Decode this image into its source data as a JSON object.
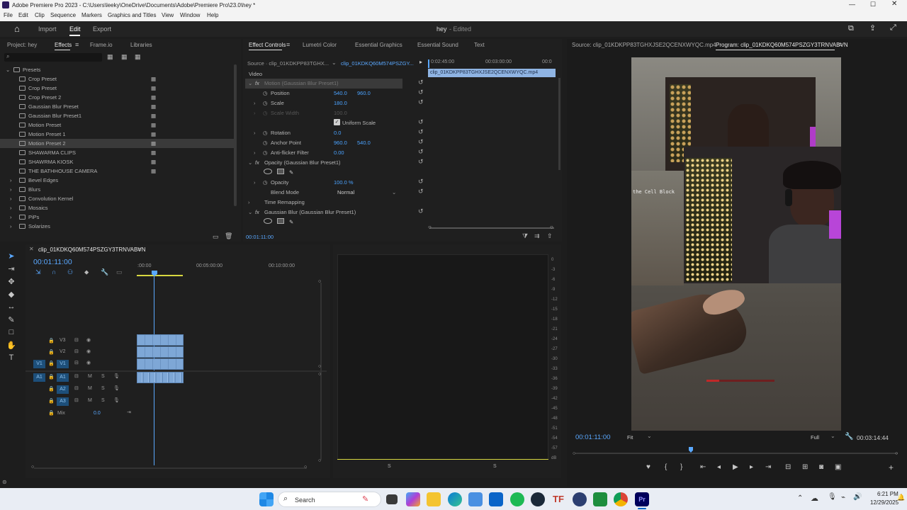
{
  "title": "Adobe Premiere Pro 2023 - C:\\Users\\leeky\\OneDrive\\Documents\\Adobe\\Premiere Pro\\23.0\\hey *",
  "menu": [
    "File",
    "Edit",
    "Clip",
    "Sequence",
    "Markers",
    "Graphics and Titles",
    "View",
    "Window",
    "Help"
  ],
  "workspace": {
    "import": "Import",
    "edit": "Edit",
    "export": "Export",
    "project_name": "hey",
    "status": "- Edited"
  },
  "effects_panel": {
    "tabs": [
      "Project: hey",
      "Effects",
      "Frame.io",
      "Libraries"
    ],
    "root": "Presets",
    "items": [
      "Crop Preset",
      "Crop Preset",
      "Crop Preset 2",
      "Gaussian Blur Preset",
      "Gaussian Blur Preset1",
      "Motion Preset",
      "Motion Preset 1",
      "Motion Preset 2",
      "SHAWARMA CLIPS",
      "SHAWRMA KIOSK",
      "THE BATHHOUSE CAMERA"
    ],
    "folders": [
      "Bevel Edges",
      "Blurs",
      "Convolution Kernel",
      "Mosaics",
      "PiPs",
      "Solarizes"
    ]
  },
  "effect_controls": {
    "tabs": [
      "Effect Controls",
      "Lumetri Color",
      "Essential Graphics",
      "Essential Sound",
      "Text"
    ],
    "source": "Source · clip_01KDKPP83TGHX...",
    "master": "clip_01KDKQ60M574PSZGY...",
    "video": "Video",
    "motion": "Motion (Gaussian Blur Preset1)",
    "position": {
      "label": "Position",
      "x": "540.0",
      "y": "960.0"
    },
    "scale": {
      "label": "Scale",
      "v": "180.0"
    },
    "scale_width": {
      "label": "Scale Width",
      "v": "100.0"
    },
    "uniform": "Uniform Scale",
    "rotation": {
      "label": "Rotation",
      "v": "0.0"
    },
    "anchor": {
      "label": "Anchor Point",
      "x": "960.0",
      "y": "540.0"
    },
    "flicker": {
      "label": "Anti-flicker Filter",
      "v": "0.00"
    },
    "opacity_group": "Opacity (Gaussian Blur Preset1)",
    "opacity": {
      "label": "Opacity",
      "v": "100.0 %"
    },
    "blend": {
      "label": "Blend Mode",
      "v": "Normal"
    },
    "time_remap": "Time Remapping",
    "gblur": "Gaussian Blur (Gaussian Blur Preset1)",
    "ruler": [
      "0:02:45:00",
      "00:03:00:00",
      "00:0"
    ],
    "clip": "clip_01KDKPP83TGHXJSE2QCENXWYQC.mp4",
    "timecode": "00:01:11:00"
  },
  "source_monitor": {
    "tab": "Source: clip_01KDKPP83TGHXJSE2QCENXWYQC.mp4"
  },
  "program": {
    "tab": "Program: clip_01KDKQ60M574PSZGY3TRNVABVN",
    "timecode": "00:01:11:00",
    "fit": "Fit",
    "full": "Full",
    "duration": "00:03:14:44",
    "overlay_text": "the Cell Block"
  },
  "timeline": {
    "tab": "clip_01KDKQ60M574PSZGY3TRNVABVN",
    "timecode": "00:01:11:00",
    "ruler": [
      ":00:00",
      "00:05:00:00",
      "00:10:00:00"
    ],
    "video_tracks": [
      "V3",
      "V2",
      "V1"
    ],
    "audio_tracks": [
      "A1",
      "A2",
      "A3"
    ],
    "src_v": "V1",
    "src_a": "A1",
    "mix": "Mix",
    "mix_val": "0.0"
  },
  "meter": {
    "ticks": [
      "0",
      "-3",
      "-6",
      "-9",
      "-12",
      "-15",
      "-18",
      "-21",
      "-24",
      "-27",
      "-30",
      "-33",
      "-36",
      "-39",
      "-42",
      "-45",
      "-48",
      "-51",
      "-54",
      "-57",
      "dB"
    ],
    "s1": "S",
    "s2": "S"
  },
  "taskbar": {
    "search": "Search",
    "time": "6:21 PM",
    "date": "12/29/2025"
  }
}
